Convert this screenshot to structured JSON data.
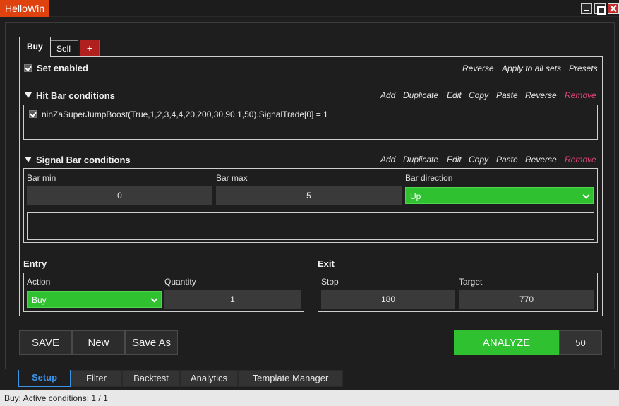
{
  "window": {
    "title": "HelloWin"
  },
  "set_tabs": {
    "buy": "Buy",
    "sell": "Sell",
    "add": "+"
  },
  "set_enabled": {
    "label": "Set enabled",
    "checked": true
  },
  "top_actions": [
    "Reverse",
    "Apply to all sets",
    "Presets"
  ],
  "hit_bar": {
    "title": "Hit Bar conditions",
    "actions": [
      "Add",
      "Duplicate",
      "Edit",
      "Copy",
      "Paste",
      "Reverse",
      "Remove"
    ],
    "conditions": [
      {
        "checked": true,
        "text": "ninZaSuperJumpBoost(True,1,2,3,4,4,20,200,30,90,1,50).SignalTrade[0] = 1"
      }
    ]
  },
  "signal_bar": {
    "title": "Signal Bar conditions",
    "actions": [
      "Add",
      "Duplicate",
      "Edit",
      "Copy",
      "Paste",
      "Reverse",
      "Remove"
    ],
    "bar_min_label": "Bar min",
    "bar_min": "0",
    "bar_max_label": "Bar max",
    "bar_max": "5",
    "bar_direction_label": "Bar direction",
    "bar_direction": "Up"
  },
  "entry": {
    "title": "Entry",
    "action_label": "Action",
    "action": "Buy",
    "quantity_label": "Quantity",
    "quantity": "1"
  },
  "exit": {
    "title": "Exit",
    "stop_label": "Stop",
    "stop": "180",
    "target_label": "Target",
    "target": "770"
  },
  "buttons": {
    "save": "SAVE",
    "new": "New",
    "save_as": "Save As",
    "analyze": "ANALYZE",
    "analyze_count": "50"
  },
  "bottom_tabs": [
    "Setup",
    "Filter",
    "Backtest",
    "Analytics",
    "Template Manager"
  ],
  "status": "Buy:  Active conditions: 1 / 1",
  "colors": {
    "accent_green": "#2fc12f",
    "title_orange": "#e0420f",
    "remove_pink": "#e2467a",
    "tab_blue": "#3b93e6"
  }
}
